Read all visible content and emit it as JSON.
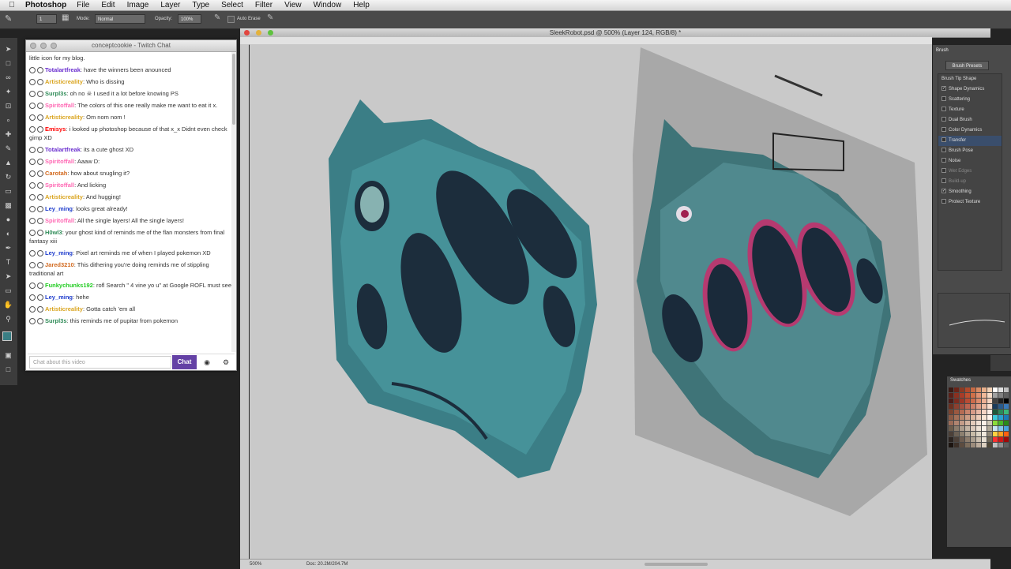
{
  "menubar": {
    "app_name": "Photoshop",
    "items": [
      "File",
      "Edit",
      "Image",
      "Layer",
      "Type",
      "Select",
      "Filter",
      "View",
      "Window",
      "Help"
    ]
  },
  "options_bar": {
    "mode_label": "Mode:",
    "mode_value": "Normal",
    "opacity_label": "Opacity:",
    "opacity_value": "100%",
    "auto_erase_label": "Auto Erase",
    "brush_size": "1"
  },
  "chat": {
    "window_title": "conceptcookie - Twitch Chat",
    "top_fragment": "little icon for my blog.",
    "messages": [
      {
        "user": "Totalartfreak",
        "color": "#6a2ecf",
        "text": ": have the winners been anounced"
      },
      {
        "user": "Artisticreality",
        "color": "#daa520",
        "text": ": Who is dissing"
      },
      {
        "user": "Surpl3s",
        "color": "#2e8b57",
        "text": ": oh no ☠ I used it a lot before knowing PS"
      },
      {
        "user": "Spiritoffall",
        "color": "#ff69b4",
        "text": ": The colors of this one really make me want to eat it x."
      },
      {
        "user": "Artisticreality",
        "color": "#daa520",
        "text": ": Om nom nom !"
      },
      {
        "user": "Emisys",
        "color": "#ff0000",
        "text": ": i looked up photoshop because of that x_x Didnt even check gimp XD"
      },
      {
        "user": "Totalartfreak",
        "color": "#6a2ecf",
        "text": ": its a cute ghost XD"
      },
      {
        "user": "Spiritoffall",
        "color": "#ff69b4",
        "text": ": Aaaw D:"
      },
      {
        "user": "Carotah",
        "color": "#d2691e",
        "text": ": how about snugling it?"
      },
      {
        "user": "Spiritoffall",
        "color": "#ff69b4",
        "text": ": And licking"
      },
      {
        "user": "Artisticreality",
        "color": "#daa520",
        "text": ": And hugging!"
      },
      {
        "user": "Ley_ming",
        "color": "#1e3ccc",
        "text": ": looks great already!"
      },
      {
        "user": "Spiritoffall",
        "color": "#ff69b4",
        "text": ": All the single layers! All the single layers!"
      },
      {
        "user": "H0wl3",
        "color": "#2e8b57",
        "text": ": your ghost kind of reminds me of the flan monsters from final fantasy xiii"
      },
      {
        "user": "Ley_ming",
        "color": "#1e3ccc",
        "text": ": Pixel art reminds me of when I played pokemon XD"
      },
      {
        "user": "Jared3210",
        "color": "#d2691e",
        "text": ": This dithering you're doing reminds me of stippling traditional art"
      },
      {
        "user": "Funkychunks192",
        "color": "#22cc22",
        "text": ": rofl Search \" 4 vine yo u\" at Google ROFL must see"
      },
      {
        "user": "Ley_ming",
        "color": "#1e3ccc",
        "text": ": hehe"
      },
      {
        "user": "Artisticreality",
        "color": "#daa520",
        "text": ": Gotta catch 'em all"
      },
      {
        "user": "Surpl3s",
        "color": "#2e8b57",
        "text": ": this reminds me of pupitar from pokemon"
      }
    ],
    "input_placeholder": "Chat about this video",
    "chat_button": "Chat"
  },
  "document": {
    "title": "SleekRobot.psd @ 500% (Layer 124, RGB/8) *",
    "zoom": "500%",
    "doc_size": "Doc: 20.2M/204.7M"
  },
  "brush_panel": {
    "tab": "Brush",
    "presets_button": "Brush Presets",
    "items": [
      {
        "label": "Brush Tip Shape",
        "checkbox": false,
        "checked": false,
        "selected": false,
        "dim": false
      },
      {
        "label": "Shape Dynamics",
        "checkbox": true,
        "checked": true,
        "selected": false,
        "dim": false
      },
      {
        "label": "Scattering",
        "checkbox": true,
        "checked": false,
        "selected": false,
        "dim": false
      },
      {
        "label": "Texture",
        "checkbox": true,
        "checked": false,
        "selected": false,
        "dim": false
      },
      {
        "label": "Dual Brush",
        "checkbox": true,
        "checked": false,
        "selected": false,
        "dim": false
      },
      {
        "label": "Color Dynamics",
        "checkbox": true,
        "checked": false,
        "selected": false,
        "dim": false
      },
      {
        "label": "Transfer",
        "checkbox": true,
        "checked": false,
        "selected": true,
        "dim": false
      },
      {
        "label": "Brush Pose",
        "checkbox": true,
        "checked": false,
        "selected": false,
        "dim": false
      },
      {
        "label": "Noise",
        "checkbox": true,
        "checked": false,
        "selected": false,
        "dim": false
      },
      {
        "label": "Wet Edges",
        "checkbox": true,
        "checked": false,
        "selected": false,
        "dim": true
      },
      {
        "label": "Build-up",
        "checkbox": true,
        "checked": false,
        "selected": false,
        "dim": true
      },
      {
        "label": "Smoothing",
        "checkbox": true,
        "checked": true,
        "selected": false,
        "dim": false
      },
      {
        "label": "Protect Texture",
        "checkbox": true,
        "checked": false,
        "selected": false,
        "dim": false
      }
    ]
  },
  "swatches": {
    "title": "Swatches",
    "colors": [
      "#3a1a14",
      "#6a2418",
      "#8c3a24",
      "#b04a2c",
      "#c86a44",
      "#d88c64",
      "#e8b08c",
      "#f0d0b4",
      "#ffffff",
      "#e0e0e0",
      "#c0c0c0",
      "#5a2018",
      "#8a3020",
      "#a83c28",
      "#c05030",
      "#d07048",
      "#e09070",
      "#f0b898",
      "#f8dcc8",
      "#a0a0a0",
      "#808080",
      "#606060",
      "#4c1c18",
      "#7c2c20",
      "#9c3828",
      "#b84c34",
      "#cc6c4c",
      "#dc8c6c",
      "#ecb094",
      "#f4d4c0",
      "#404040",
      "#202020",
      "#000000",
      "#6c3020",
      "#8c4030",
      "#a45040",
      "#bc6450",
      "#cc8068",
      "#dc9c84",
      "#ecbca4",
      "#f8dccc",
      "#1a3a5a",
      "#2a5a8a",
      "#3a7aba",
      "#7c4430",
      "#9c5840",
      "#b46c54",
      "#c8846c",
      "#d89c88",
      "#e8b8a4",
      "#f4d4c4",
      "#fcece4",
      "#1a5a3a",
      "#2a8a5a",
      "#3aba7a",
      "#8c5a44",
      "#a47058",
      "#b8866c",
      "#cc9c84",
      "#dcb49c",
      "#ecccb8",
      "#f8e4d4",
      "#fff4ec",
      "#3acad8",
      "#2aa0d0",
      "#1a7ab8",
      "#9c6c58",
      "#b08470",
      "#c49c88",
      "#d4b4a0",
      "#e4ccbc",
      "#f0e0d4",
      "#fcf0e8",
      "#d0c8b8",
      "#8adc3a",
      "#4ab82a",
      "#2a8a1a",
      "#6c5c4c",
      "#8c7c6c",
      "#ac9c8c",
      "#c4b4a4",
      "#dccabc",
      "#ece0d4",
      "#f8f0e8",
      "#b0a898",
      "#c8e4f4",
      "#88c4e8",
      "#48a4dc",
      "#4c4038",
      "#6c6054",
      "#8c8070",
      "#aca090",
      "#c8bca8",
      "#dcd4c4",
      "#f0e8dc",
      "#908878",
      "#ffd040",
      "#ffa020",
      "#ff6010",
      "#2c2420",
      "#4c4038",
      "#6c5c50",
      "#8c7c6c",
      "#aca090",
      "#ccc0b0",
      "#e8e0d4",
      "#706858",
      "#ff3030",
      "#d01818",
      "#a00808",
      "#1c1410",
      "#3c3028",
      "#5c4c40",
      "#7c6c5c",
      "#9c8c7c",
      "#bcac9c",
      "#dcd0c0",
      "#504838",
      "#c0c0c0",
      "#909090",
      "#606060"
    ]
  }
}
